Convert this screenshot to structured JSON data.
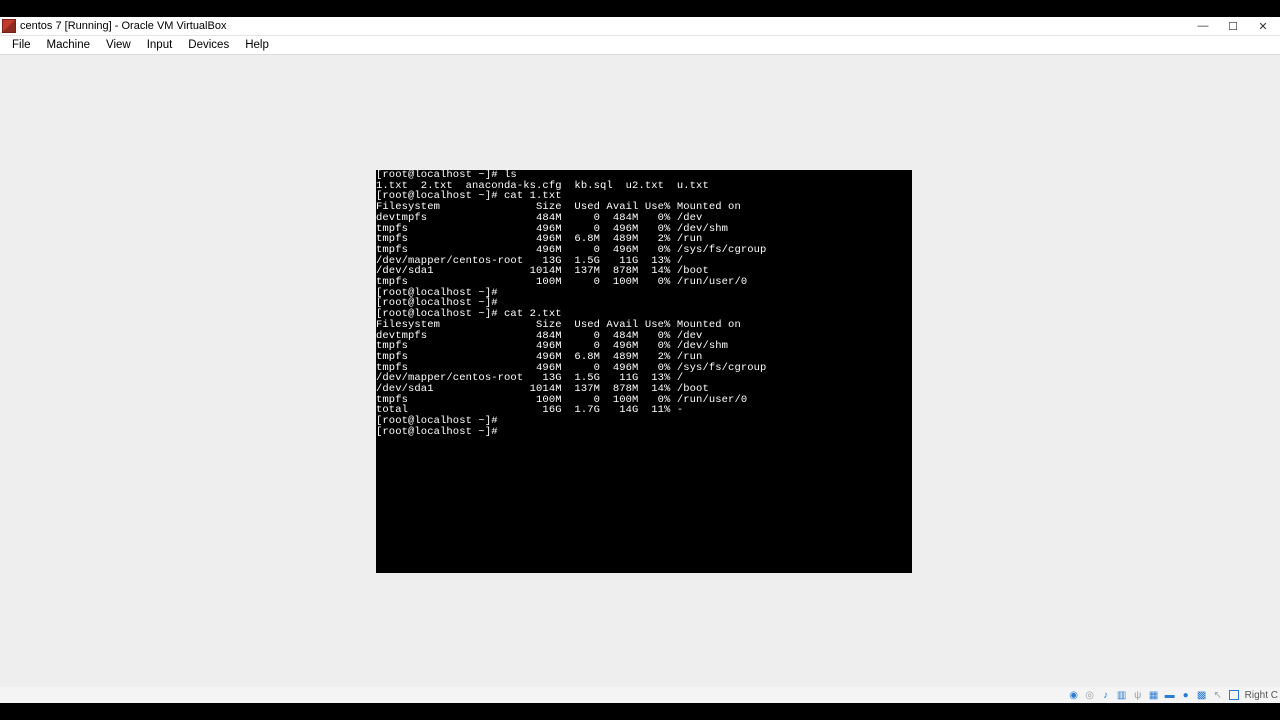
{
  "window": {
    "title": "centos 7 [Running] - Oracle VM VirtualBox"
  },
  "menubar": {
    "items": [
      "File",
      "Machine",
      "View",
      "Input",
      "Devices",
      "Help"
    ]
  },
  "statusbar": {
    "hostkey": "Right C"
  },
  "terminal": {
    "prompt": "[root@localhost ~]#",
    "cmd_ls": "ls",
    "ls_output": "1.txt  2.txt  anaconda-ks.cfg  kb.sql  u2.txt  u.txt",
    "cmd_cat1": "cat 1.txt",
    "df_header": "Filesystem               Size  Used Avail Use% Mounted on",
    "df1": [
      {
        "fs": "devtmpfs",
        "size": "484M",
        "used": "0",
        "avail": "484M",
        "use": "0%",
        "mnt": "/dev"
      },
      {
        "fs": "tmpfs",
        "size": "496M",
        "used": "0",
        "avail": "496M",
        "use": "0%",
        "mnt": "/dev/shm"
      },
      {
        "fs": "tmpfs",
        "size": "496M",
        "used": "6.8M",
        "avail": "489M",
        "use": "2%",
        "mnt": "/run"
      },
      {
        "fs": "tmpfs",
        "size": "496M",
        "used": "0",
        "avail": "496M",
        "use": "0%",
        "mnt": "/sys/fs/cgroup"
      },
      {
        "fs": "/dev/mapper/centos-root",
        "size": "13G",
        "used": "1.5G",
        "avail": "11G",
        "use": "13%",
        "mnt": "/"
      },
      {
        "fs": "/dev/sda1",
        "size": "1014M",
        "used": "137M",
        "avail": "878M",
        "use": "14%",
        "mnt": "/boot"
      },
      {
        "fs": "tmpfs",
        "size": "100M",
        "used": "0",
        "avail": "100M",
        "use": "0%",
        "mnt": "/run/user/0"
      }
    ],
    "cmd_cat2": "cat 2.txt",
    "df2": [
      {
        "fs": "devtmpfs",
        "size": "484M",
        "used": "0",
        "avail": "484M",
        "use": "0%",
        "mnt": "/dev"
      },
      {
        "fs": "tmpfs",
        "size": "496M",
        "used": "0",
        "avail": "496M",
        "use": "0%",
        "mnt": "/dev/shm"
      },
      {
        "fs": "tmpfs",
        "size": "496M",
        "used": "6.8M",
        "avail": "489M",
        "use": "2%",
        "mnt": "/run"
      },
      {
        "fs": "tmpfs",
        "size": "496M",
        "used": "0",
        "avail": "496M",
        "use": "0%",
        "mnt": "/sys/fs/cgroup"
      },
      {
        "fs": "/dev/mapper/centos-root",
        "size": "13G",
        "used": "1.5G",
        "avail": "11G",
        "use": "13%",
        "mnt": "/"
      },
      {
        "fs": "/dev/sda1",
        "size": "1014M",
        "used": "137M",
        "avail": "878M",
        "use": "14%",
        "mnt": "/boot"
      },
      {
        "fs": "tmpfs",
        "size": "100M",
        "used": "0",
        "avail": "100M",
        "use": "0%",
        "mnt": "/run/user/0"
      },
      {
        "fs": "total",
        "size": "16G",
        "used": "1.7G",
        "avail": "14G",
        "use": "11%",
        "mnt": "-"
      }
    ]
  }
}
